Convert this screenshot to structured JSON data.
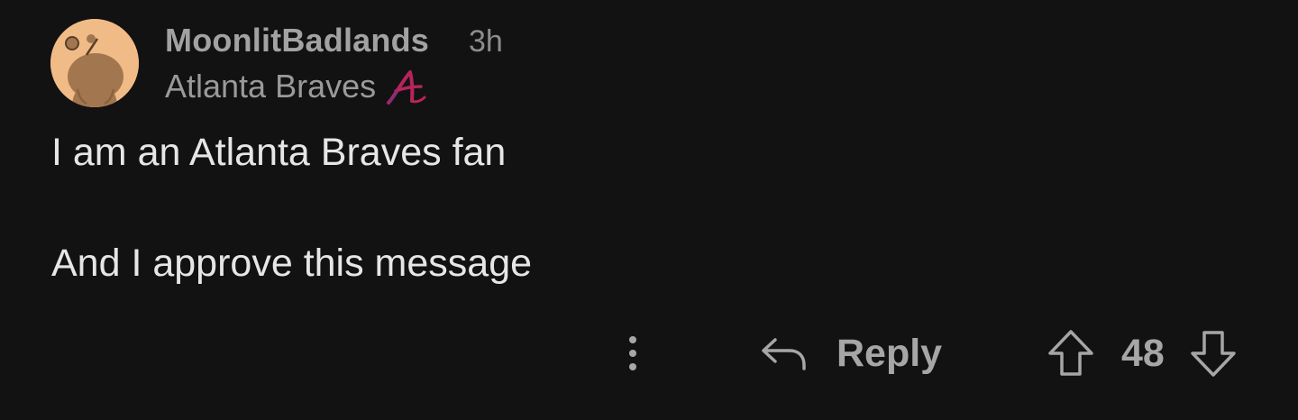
{
  "comment": {
    "author": "MoonlitBadlands",
    "time_ago": "3h",
    "flair": {
      "text": "Atlanta Braves",
      "emoji_icon": "atlanta-braves-a-logo",
      "emoji_color": "#b7245c"
    },
    "body": [
      "I am an Atlanta Braves fan",
      "And I approve this message"
    ],
    "avatar": {
      "icon": "snoo-avatar",
      "background": "#f1bb87"
    }
  },
  "actions": {
    "more_icon": "vertical-ellipsis-icon",
    "reply_icon": "reply-arrow-icon",
    "reply_label": "Reply",
    "upvote_icon": "upvote-arrow-icon",
    "score": "48",
    "downvote_icon": "downvote-arrow-icon"
  },
  "colors": {
    "background": "#121212",
    "primary_text": "#e6e6e6",
    "muted_text": "#a2a2a2"
  }
}
